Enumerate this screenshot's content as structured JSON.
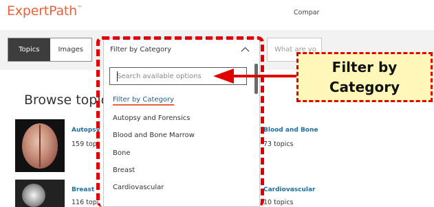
{
  "header": {
    "logo": "ExpertPath",
    "logo_tm": "™",
    "nav_compare": "Compar"
  },
  "tabs": [
    {
      "label": "Topics",
      "active": true
    },
    {
      "label": "Images",
      "active": false
    }
  ],
  "category_select": {
    "value": "Filter by Category",
    "icon": "chevron-up-icon"
  },
  "search_field": {
    "placeholder": "What are yo"
  },
  "dropdown": {
    "search_placeholder": "Search available options",
    "options": [
      {
        "label": "Filter by Category",
        "selected": true
      },
      {
        "label": "Autopsy and Forensics",
        "selected": false
      },
      {
        "label": "Blood and Bone Marrow",
        "selected": false
      },
      {
        "label": "Bone",
        "selected": false
      },
      {
        "label": "Breast",
        "selected": false
      },
      {
        "label": "Cardiovascular",
        "selected": false
      }
    ]
  },
  "browse": {
    "heading": "Browse topic"
  },
  "categories_left": [
    {
      "name": "Autopsy",
      "count": "159 topi"
    },
    {
      "name": "Breast",
      "count": "116 topi"
    }
  ],
  "categories_right": [
    {
      "name": "Blood and Bone",
      "count": "73 topics"
    },
    {
      "name": "Cardiovascular",
      "count": "10 topics"
    }
  ],
  "annotation": {
    "line1": "Filter by",
    "line2": "Category",
    "color": "#e00000",
    "fill": "#fff8b8"
  },
  "colors": {
    "brand": "#e8623a",
    "link": "#1f6f9e",
    "tab_active": "#3d3d3d"
  }
}
